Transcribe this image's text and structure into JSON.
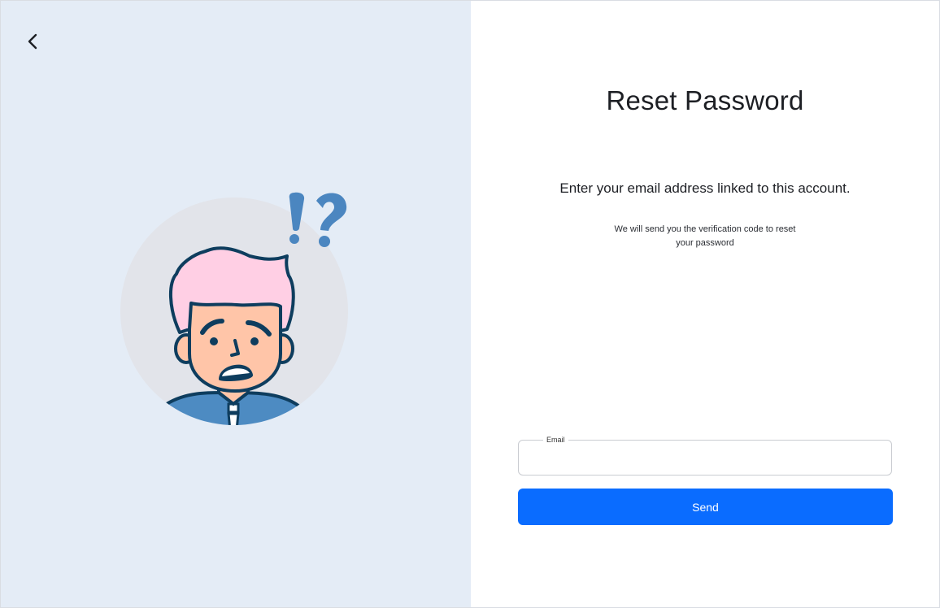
{
  "header": {
    "back_icon": "chevron-left-icon"
  },
  "illustration": {
    "icon": "confused-man-illustration",
    "colors": {
      "circle": "#e2e4ea",
      "hair": "#ffcfe4",
      "skin": "#ffc5a8",
      "shirt": "#4d8bc2",
      "outline": "#0e3d5e",
      "symbols": "#4b86c0"
    }
  },
  "form": {
    "title": "Reset Password",
    "subtitle": "Enter your email address linked to this account.",
    "description": "We will send you the verification code to reset your password",
    "email_label": "Email",
    "email_value": "",
    "send_label": "Send"
  },
  "colors": {
    "left_background": "#e4ecf6",
    "accent": "#0a6cff"
  }
}
